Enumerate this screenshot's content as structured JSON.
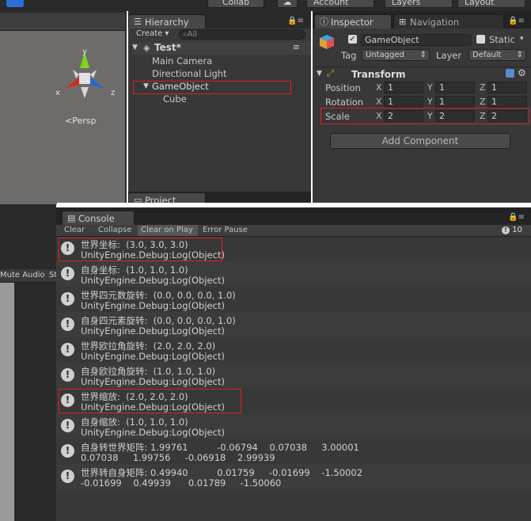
{
  "topbar": {
    "collab": "Collab",
    "account": "Account",
    "layers": "Layers",
    "layout": "Layout"
  },
  "scene": {
    "persp": "Persp",
    "gizmo": {
      "y": "y",
      "x": "x",
      "z": "z"
    },
    "mute_audio": "Mute Audio",
    "st": "St"
  },
  "hierarchy": {
    "tab": "Hierarchy",
    "create": "Create",
    "search_placeholder": "All",
    "scene_name": "Test*",
    "items": [
      "Main Camera",
      "Directional Light",
      "GameObject",
      "Cube"
    ],
    "project_tab": "Project"
  },
  "inspector": {
    "tab": "Inspector",
    "nav_tab": "Navigation",
    "object_name": "GameObject",
    "static_label": "Static",
    "tag_label": "Tag",
    "tag_value": "Untagged",
    "layer_label": "Layer",
    "layer_value": "Default",
    "component": "Transform",
    "rows": [
      {
        "label": "Position",
        "x": "1",
        "y": "1",
        "z": "1"
      },
      {
        "label": "Rotation",
        "x": "1",
        "y": "1",
        "z": "1"
      },
      {
        "label": "Scale",
        "x": "2",
        "y": "2",
        "z": "2"
      }
    ],
    "axis": {
      "x": "X",
      "y": "Y",
      "z": "Z"
    },
    "add_component": "Add Component"
  },
  "console": {
    "tab": "Console",
    "toolbar": [
      "Clear",
      "Collapse",
      "Clear on Play",
      "Error Pause"
    ],
    "count": "10",
    "entries": [
      {
        "l1": "世界坐标:  (3.0, 3.0, 3.0)",
        "l2": "UnityEngine.Debug:Log(Object)"
      },
      {
        "l1": "自身坐标:  (1.0, 1.0, 1.0)",
        "l2": "UnityEngine.Debug:Log(Object)"
      },
      {
        "l1": "世界四元数旋转:  (0.0, 0.0, 0.0, 1.0)",
        "l2": "UnityEngine.Debug:Log(Object)"
      },
      {
        "l1": "自身四元素旋转:  (0.0, 0.0, 0.0, 1.0)",
        "l2": "UnityEngine.Debug:Log(Object)"
      },
      {
        "l1": "世界欧拉角旋转:  (2.0, 2.0, 2.0)",
        "l2": "UnityEngine.Debug:Log(Object)"
      },
      {
        "l1": "自身欧拉角旋转:  (1.0, 1.0, 1.0)",
        "l2": "UnityEngine.Debug:Log(Object)"
      },
      {
        "l1": "世界缩放:  (2.0, 2.0, 2.0)",
        "l2": "UnityEngine.Debug:Log(Object)"
      },
      {
        "l1": "自身缩放:  (1.0, 1.0, 1.0)",
        "l2": "UnityEngine.Debug:Log(Object)"
      },
      {
        "l1": "自身转世界矩阵: 1.99761          -0.06794    0.07038     3.00001",
        "l2": "0.07038     1.99756     -0.06918    2.99939"
      },
      {
        "l1": "世界转自身矩阵: 0.49940          0.01759     -0.01699    -1.50002",
        "l2": "-0.01699    0.49939      0.01789     -1.50060"
      }
    ]
  },
  "colors": {
    "highlight": "#e02020",
    "panel": "#383838",
    "dark": "#232323"
  }
}
